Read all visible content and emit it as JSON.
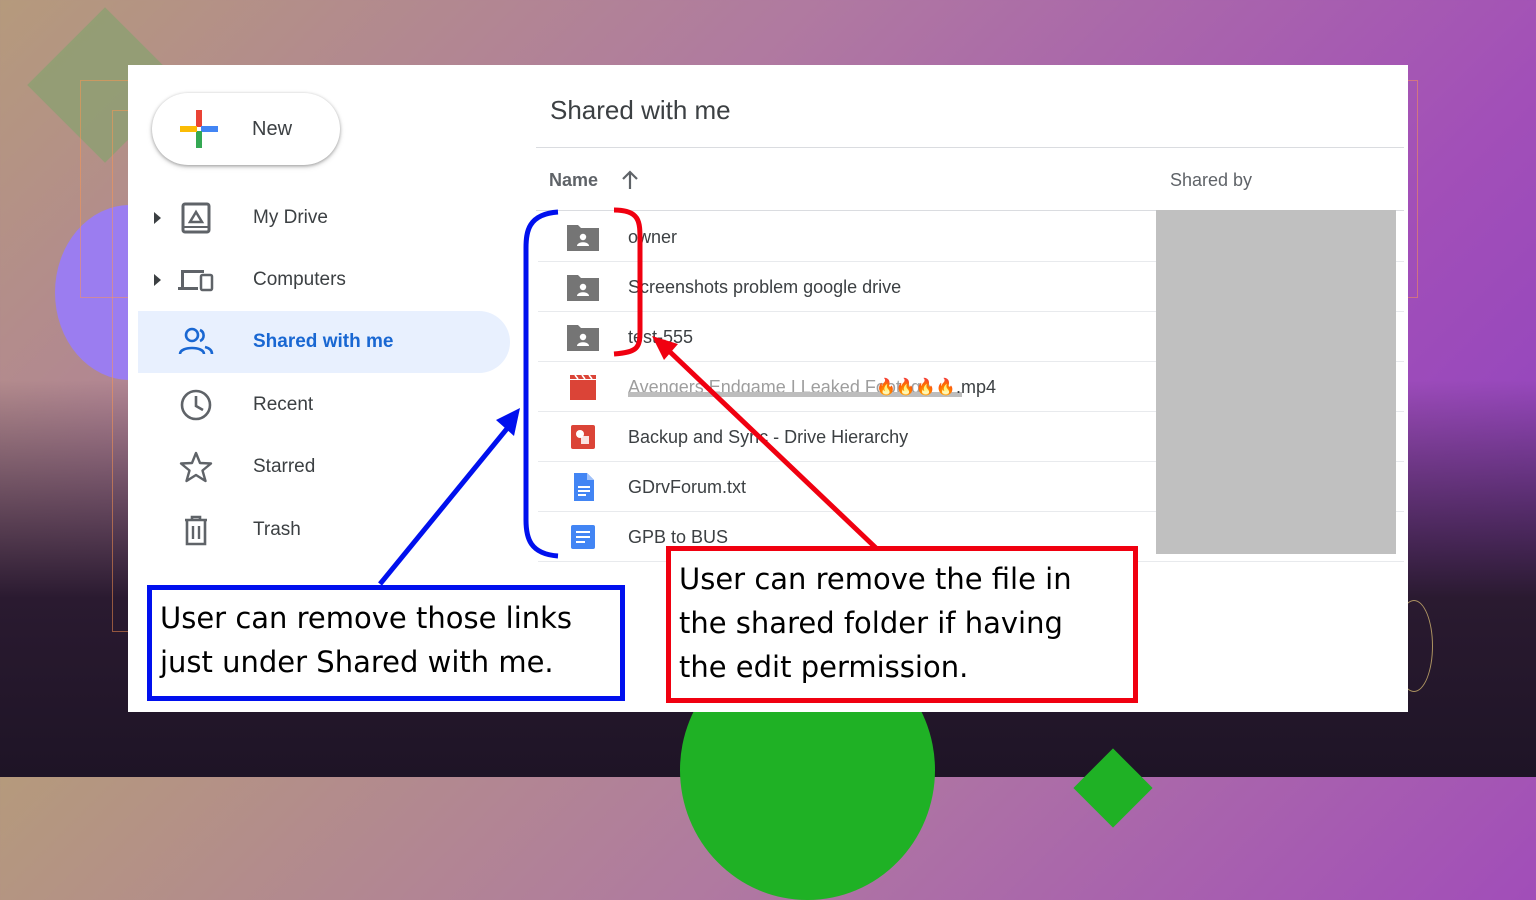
{
  "sidebar": {
    "new_label": "New",
    "items": [
      {
        "label": "My Drive",
        "icon": "my-drive-icon"
      },
      {
        "label": "Computers",
        "icon": "computers-icon"
      },
      {
        "label": "Shared with me",
        "icon": "people-icon"
      },
      {
        "label": "Recent",
        "icon": "clock-icon"
      },
      {
        "label": "Starred",
        "icon": "star-icon"
      },
      {
        "label": "Trash",
        "icon": "trash-icon"
      }
    ]
  },
  "main": {
    "title": "Shared with me",
    "columns": {
      "name": "Name",
      "shared_by": "Shared by"
    },
    "files": [
      {
        "name": "owner",
        "icon": "shared-folder-icon"
      },
      {
        "name": "Screenshots problem google drive",
        "icon": "shared-folder-icon"
      },
      {
        "name": "test-555",
        "icon": "shared-folder-icon"
      },
      {
        "name": "Avengers Endgame I Leaked Footage",
        "suffix": ".mp4",
        "icon": "video-file-icon"
      },
      {
        "name": "Backup and Sync - Drive Hierarchy",
        "icon": "drawing-file-icon"
      },
      {
        "name": "GDrvForum.txt",
        "icon": "text-file-icon"
      },
      {
        "name": "GPB to BUS",
        "icon": "docs-file-icon"
      }
    ]
  },
  "annotations": {
    "blue_note": [
      "User can remove those links",
      "just under Shared with me."
    ],
    "red_note": [
      "User can remove the file in",
      "the shared folder if having",
      "the edit permission."
    ],
    "colors": {
      "blue": "#0010ee",
      "red": "#f00010"
    }
  },
  "colors": {
    "accent": "#1967d2",
    "active_bg": "#e8f0fe"
  }
}
